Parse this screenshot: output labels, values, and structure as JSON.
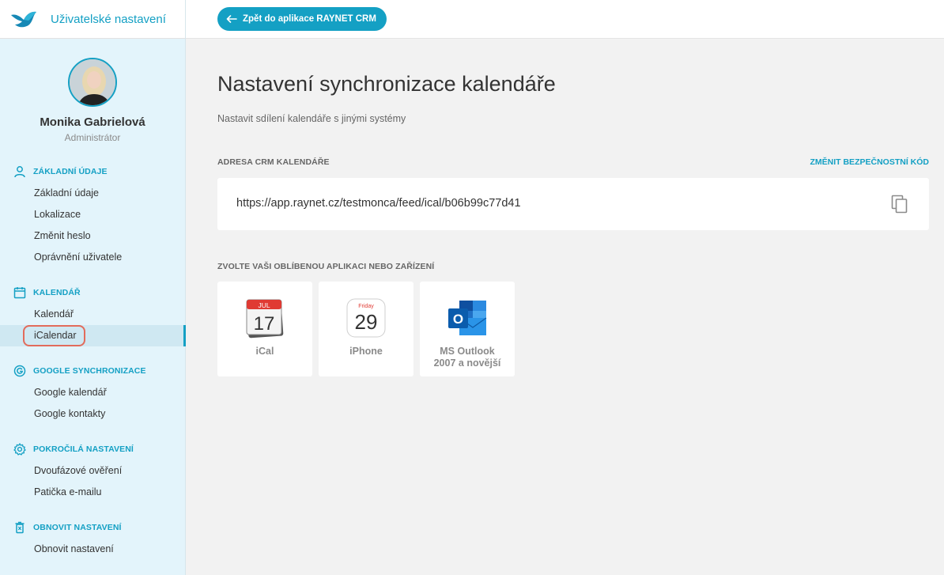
{
  "sidebar": {
    "title": "Uživatelské nastavení",
    "user_name": "Monika Gabrielová",
    "user_role": "Administrátor",
    "sections": [
      {
        "label": "ZÁKLADNÍ ÚDAJE",
        "icon": "person-icon",
        "items": [
          "Základní údaje",
          "Lokalizace",
          "Změnit heslo",
          "Oprávnění uživatele"
        ]
      },
      {
        "label": "KALENDÁŘ",
        "icon": "calendar-icon",
        "items": [
          "Kalendář",
          "iCalendar"
        ]
      },
      {
        "label": "GOOGLE SYNCHRONIZACE",
        "icon": "google-icon",
        "items": [
          "Google kalendář",
          "Google kontakty"
        ]
      },
      {
        "label": "POKROČILÁ NASTAVENÍ",
        "icon": "gear-icon",
        "items": [
          "Dvoufázové ověření",
          "Patička e-mailu"
        ]
      },
      {
        "label": "OBNOVIT NASTAVENÍ",
        "icon": "trash-icon",
        "items": [
          "Obnovit nastavení"
        ]
      }
    ],
    "active_item": "iCalendar"
  },
  "topbar": {
    "back_label": "Zpět do aplikace RAYNET CRM"
  },
  "main": {
    "title": "Nastavení synchronizace kalendáře",
    "subtitle": "Nastavit sdílení kalendáře s jinými systémy",
    "address_label": "ADRESA CRM KALENDÁŘE",
    "change_code_link": "ZMĚNIT BEZPEČNOSTNÍ KÓD",
    "calendar_url": "https://app.raynet.cz/testmonca/feed/ical/b06b99c77d41",
    "choose_label": "ZVOLTE VAŠI OBLÍBENOU APLIKACI NEBO ZAŘÍZENÍ",
    "apps": [
      {
        "label": "iCal",
        "icon": "ical-icon",
        "icon_month": "JUL",
        "icon_day": "17"
      },
      {
        "label": "iPhone",
        "icon": "iphone-calendar-icon",
        "icon_weekday": "Friday",
        "icon_day": "29"
      },
      {
        "label_line1": "MS Outlook",
        "label_line2": "2007 a novější",
        "icon": "outlook-icon",
        "icon_letter": "O"
      }
    ]
  },
  "colors": {
    "accent": "#14a0c4",
    "highlight": "#e26b5b"
  }
}
